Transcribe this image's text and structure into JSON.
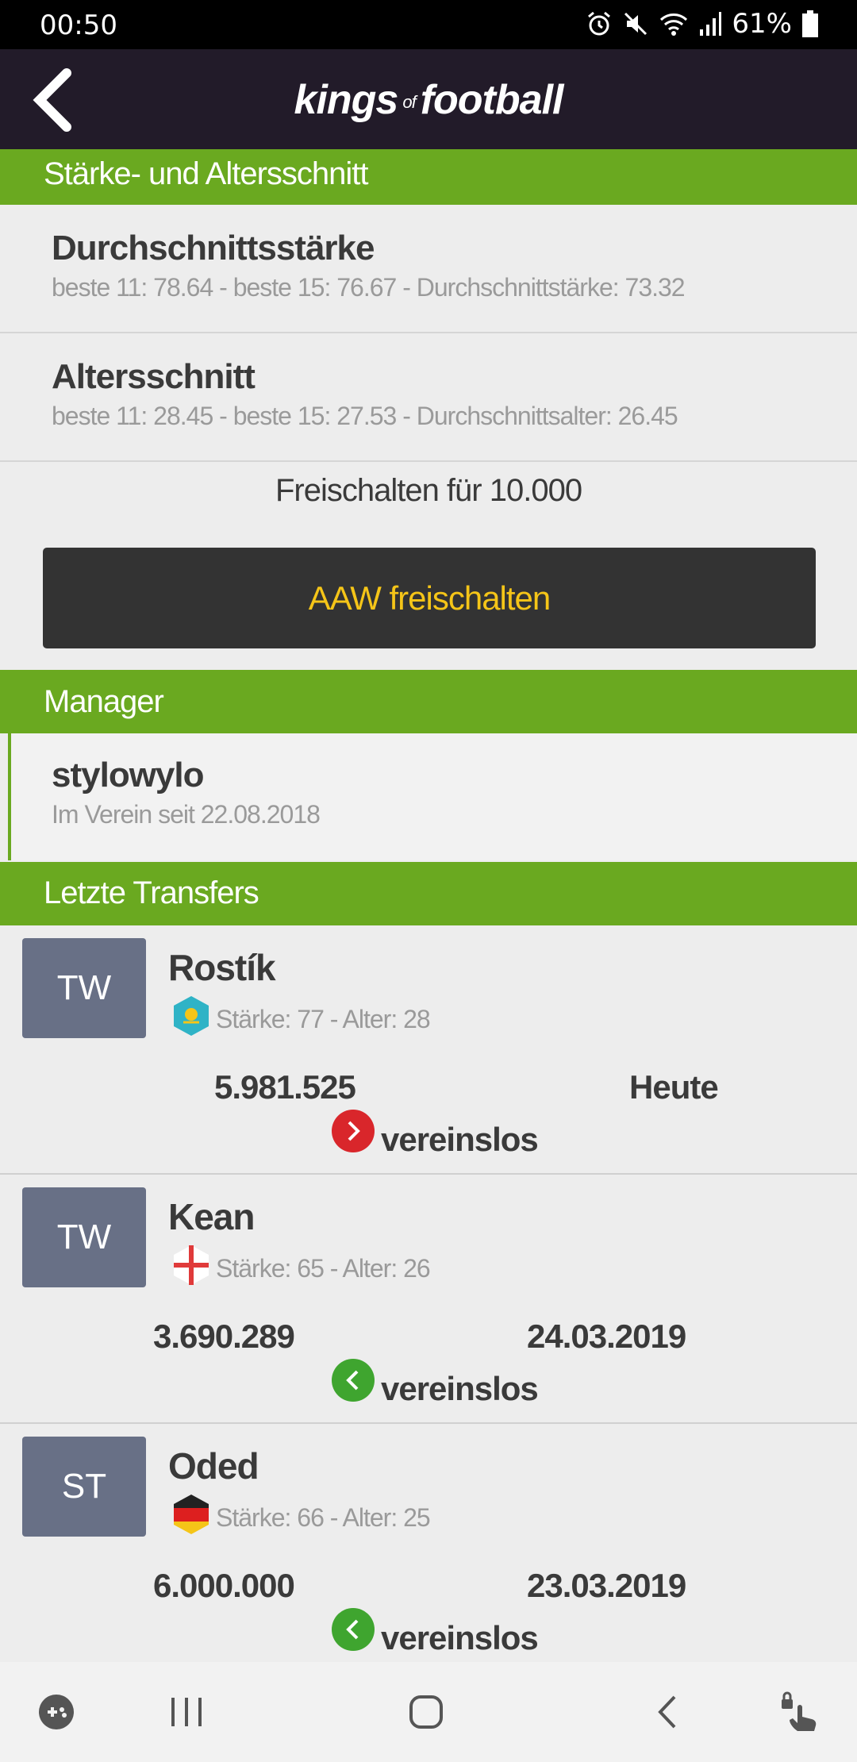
{
  "status_bar": {
    "time": "00:50",
    "battery": "61%"
  },
  "app_bar": {
    "logo_left": "kings",
    "logo_mid": "of",
    "logo_right": "football"
  },
  "section_strength": {
    "header": "Stärke- und Altersschnitt",
    "strength_title": "Durchschnittsstärke",
    "strength_sub": "beste 11: 78.64 - beste 15: 76.67 - Durchschnittstärke: 73.32",
    "age_title": "Altersschnitt",
    "age_sub": "beste 11: 28.45 - beste 15: 27.53 - Durchschnittsalter: 26.45",
    "unlock_text": "Freischalten für 10.000",
    "unlock_button": "AAW freischalten"
  },
  "section_manager": {
    "header": "Manager",
    "name": "stylowylo",
    "since": "Im Verein seit 22.08.2018"
  },
  "section_transfers": {
    "header": "Letzte Transfers",
    "items": [
      {
        "position": "TW",
        "name": "Rostík",
        "meta": "Stärke: 77 - Alter: 28",
        "price": "5.981.525",
        "date": "Heute",
        "club": "vereinslos",
        "direction": "out",
        "flag": "kazakhstan-flag-icon"
      },
      {
        "position": "TW",
        "name": "Kean",
        "meta": "Stärke: 65 - Alter: 26",
        "price": "3.690.289",
        "date": "24.03.2019",
        "club": "vereinslos",
        "direction": "in",
        "flag": "england-flag-icon"
      },
      {
        "position": "ST",
        "name": "Oded",
        "meta": "Stärke: 66 - Alter: 25",
        "price": "6.000.000",
        "date": "23.03.2019",
        "club": "vereinslos",
        "direction": "in",
        "flag": "germany-flag-icon"
      }
    ]
  },
  "colors": {
    "accent_green": "#6aa920",
    "app_bar": "#221b29",
    "button_text": "#f5c518",
    "out_red": "#d9262b",
    "in_green": "#3fa52f"
  }
}
